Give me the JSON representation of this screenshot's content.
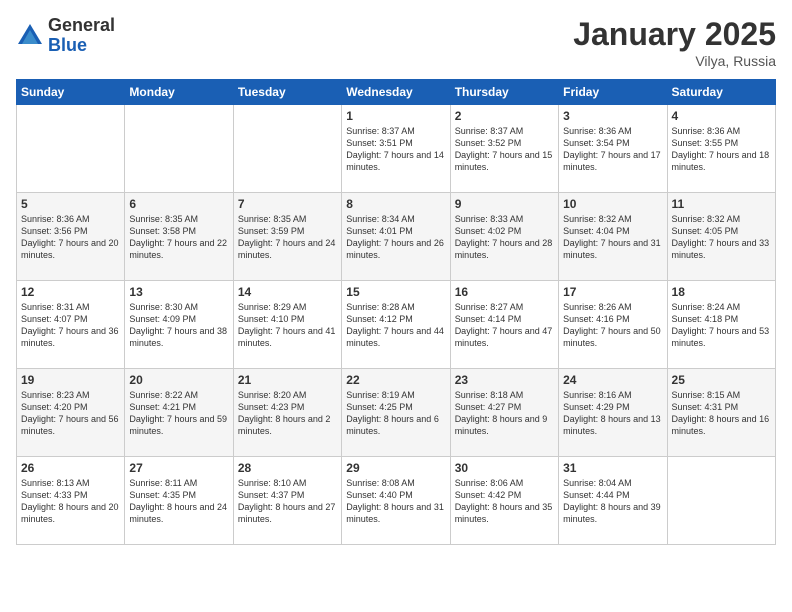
{
  "logo": {
    "general": "General",
    "blue": "Blue"
  },
  "title": "January 2025",
  "location": "Vilya, Russia",
  "days_header": [
    "Sunday",
    "Monday",
    "Tuesday",
    "Wednesday",
    "Thursday",
    "Friday",
    "Saturday"
  ],
  "weeks": [
    [
      {
        "num": "",
        "sunrise": "",
        "sunset": "",
        "daylight": ""
      },
      {
        "num": "",
        "sunrise": "",
        "sunset": "",
        "daylight": ""
      },
      {
        "num": "",
        "sunrise": "",
        "sunset": "",
        "daylight": ""
      },
      {
        "num": "1",
        "sunrise": "Sunrise: 8:37 AM",
        "sunset": "Sunset: 3:51 PM",
        "daylight": "Daylight: 7 hours and 14 minutes."
      },
      {
        "num": "2",
        "sunrise": "Sunrise: 8:37 AM",
        "sunset": "Sunset: 3:52 PM",
        "daylight": "Daylight: 7 hours and 15 minutes."
      },
      {
        "num": "3",
        "sunrise": "Sunrise: 8:36 AM",
        "sunset": "Sunset: 3:54 PM",
        "daylight": "Daylight: 7 hours and 17 minutes."
      },
      {
        "num": "4",
        "sunrise": "Sunrise: 8:36 AM",
        "sunset": "Sunset: 3:55 PM",
        "daylight": "Daylight: 7 hours and 18 minutes."
      }
    ],
    [
      {
        "num": "5",
        "sunrise": "Sunrise: 8:36 AM",
        "sunset": "Sunset: 3:56 PM",
        "daylight": "Daylight: 7 hours and 20 minutes."
      },
      {
        "num": "6",
        "sunrise": "Sunrise: 8:35 AM",
        "sunset": "Sunset: 3:58 PM",
        "daylight": "Daylight: 7 hours and 22 minutes."
      },
      {
        "num": "7",
        "sunrise": "Sunrise: 8:35 AM",
        "sunset": "Sunset: 3:59 PM",
        "daylight": "Daylight: 7 hours and 24 minutes."
      },
      {
        "num": "8",
        "sunrise": "Sunrise: 8:34 AM",
        "sunset": "Sunset: 4:01 PM",
        "daylight": "Daylight: 7 hours and 26 minutes."
      },
      {
        "num": "9",
        "sunrise": "Sunrise: 8:33 AM",
        "sunset": "Sunset: 4:02 PM",
        "daylight": "Daylight: 7 hours and 28 minutes."
      },
      {
        "num": "10",
        "sunrise": "Sunrise: 8:32 AM",
        "sunset": "Sunset: 4:04 PM",
        "daylight": "Daylight: 7 hours and 31 minutes."
      },
      {
        "num": "11",
        "sunrise": "Sunrise: 8:32 AM",
        "sunset": "Sunset: 4:05 PM",
        "daylight": "Daylight: 7 hours and 33 minutes."
      }
    ],
    [
      {
        "num": "12",
        "sunrise": "Sunrise: 8:31 AM",
        "sunset": "Sunset: 4:07 PM",
        "daylight": "Daylight: 7 hours and 36 minutes."
      },
      {
        "num": "13",
        "sunrise": "Sunrise: 8:30 AM",
        "sunset": "Sunset: 4:09 PM",
        "daylight": "Daylight: 7 hours and 38 minutes."
      },
      {
        "num": "14",
        "sunrise": "Sunrise: 8:29 AM",
        "sunset": "Sunset: 4:10 PM",
        "daylight": "Daylight: 7 hours and 41 minutes."
      },
      {
        "num": "15",
        "sunrise": "Sunrise: 8:28 AM",
        "sunset": "Sunset: 4:12 PM",
        "daylight": "Daylight: 7 hours and 44 minutes."
      },
      {
        "num": "16",
        "sunrise": "Sunrise: 8:27 AM",
        "sunset": "Sunset: 4:14 PM",
        "daylight": "Daylight: 7 hours and 47 minutes."
      },
      {
        "num": "17",
        "sunrise": "Sunrise: 8:26 AM",
        "sunset": "Sunset: 4:16 PM",
        "daylight": "Daylight: 7 hours and 50 minutes."
      },
      {
        "num": "18",
        "sunrise": "Sunrise: 8:24 AM",
        "sunset": "Sunset: 4:18 PM",
        "daylight": "Daylight: 7 hours and 53 minutes."
      }
    ],
    [
      {
        "num": "19",
        "sunrise": "Sunrise: 8:23 AM",
        "sunset": "Sunset: 4:20 PM",
        "daylight": "Daylight: 7 hours and 56 minutes."
      },
      {
        "num": "20",
        "sunrise": "Sunrise: 8:22 AM",
        "sunset": "Sunset: 4:21 PM",
        "daylight": "Daylight: 7 hours and 59 minutes."
      },
      {
        "num": "21",
        "sunrise": "Sunrise: 8:20 AM",
        "sunset": "Sunset: 4:23 PM",
        "daylight": "Daylight: 8 hours and 2 minutes."
      },
      {
        "num": "22",
        "sunrise": "Sunrise: 8:19 AM",
        "sunset": "Sunset: 4:25 PM",
        "daylight": "Daylight: 8 hours and 6 minutes."
      },
      {
        "num": "23",
        "sunrise": "Sunrise: 8:18 AM",
        "sunset": "Sunset: 4:27 PM",
        "daylight": "Daylight: 8 hours and 9 minutes."
      },
      {
        "num": "24",
        "sunrise": "Sunrise: 8:16 AM",
        "sunset": "Sunset: 4:29 PM",
        "daylight": "Daylight: 8 hours and 13 minutes."
      },
      {
        "num": "25",
        "sunrise": "Sunrise: 8:15 AM",
        "sunset": "Sunset: 4:31 PM",
        "daylight": "Daylight: 8 hours and 16 minutes."
      }
    ],
    [
      {
        "num": "26",
        "sunrise": "Sunrise: 8:13 AM",
        "sunset": "Sunset: 4:33 PM",
        "daylight": "Daylight: 8 hours and 20 minutes."
      },
      {
        "num": "27",
        "sunrise": "Sunrise: 8:11 AM",
        "sunset": "Sunset: 4:35 PM",
        "daylight": "Daylight: 8 hours and 24 minutes."
      },
      {
        "num": "28",
        "sunrise": "Sunrise: 8:10 AM",
        "sunset": "Sunset: 4:37 PM",
        "daylight": "Daylight: 8 hours and 27 minutes."
      },
      {
        "num": "29",
        "sunrise": "Sunrise: 8:08 AM",
        "sunset": "Sunset: 4:40 PM",
        "daylight": "Daylight: 8 hours and 31 minutes."
      },
      {
        "num": "30",
        "sunrise": "Sunrise: 8:06 AM",
        "sunset": "Sunset: 4:42 PM",
        "daylight": "Daylight: 8 hours and 35 minutes."
      },
      {
        "num": "31",
        "sunrise": "Sunrise: 8:04 AM",
        "sunset": "Sunset: 4:44 PM",
        "daylight": "Daylight: 8 hours and 39 minutes."
      },
      {
        "num": "",
        "sunrise": "",
        "sunset": "",
        "daylight": ""
      }
    ]
  ]
}
